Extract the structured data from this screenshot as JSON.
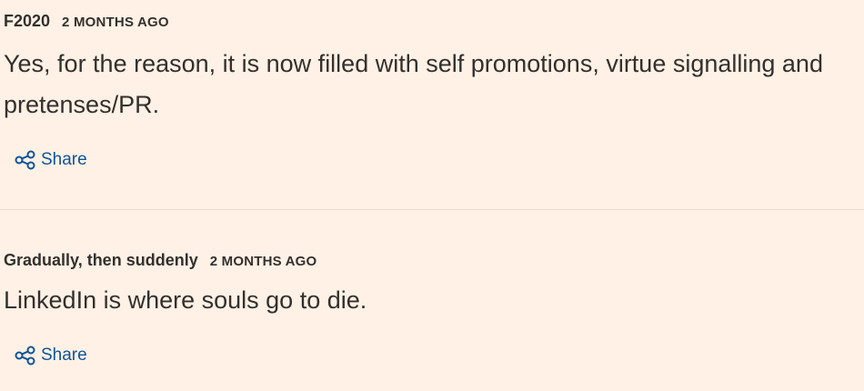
{
  "comments": [
    {
      "author": "F2020",
      "timestamp": "2 MONTHS AGO",
      "body": "Yes, for the reason, it is now filled with self promotions, virtue signalling and pretenses/PR.",
      "share_label": "Share",
      "share_icon": "share-icon"
    },
    {
      "author": "Gradually, then suddenly",
      "timestamp": "2 MONTHS AGO",
      "body": "LinkedIn is where souls go to die.",
      "share_label": "Share",
      "share_icon": "share-icon"
    }
  ],
  "colors": {
    "background": "#FFF1E5",
    "text": "#33302E",
    "link": "#0F5499",
    "divider": "#E6D9CE"
  }
}
